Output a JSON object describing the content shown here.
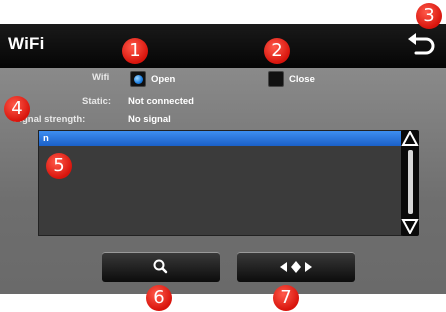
{
  "header": {
    "title": "WiFi"
  },
  "wifi": {
    "label": "Wifi",
    "open_label": "Open",
    "close_label": "Close",
    "selected": "Open"
  },
  "static": {
    "label": "Static:",
    "value": "Not connected"
  },
  "signal": {
    "label": "Signal strength:",
    "value": "No signal"
  },
  "networks": [
    {
      "name": "n",
      "selected": true
    }
  ],
  "callouts": [
    "1",
    "2",
    "3",
    "4",
    "5",
    "6",
    "7"
  ],
  "icons": {
    "back": "back-arrow-icon",
    "search": "search-icon",
    "connect": "connect-arrows-icon",
    "scroll_up": "scroll-up-icon",
    "scroll_down": "scroll-down-icon"
  },
  "colors": {
    "selection": "#2a77e0",
    "badge": "#e0201a"
  }
}
